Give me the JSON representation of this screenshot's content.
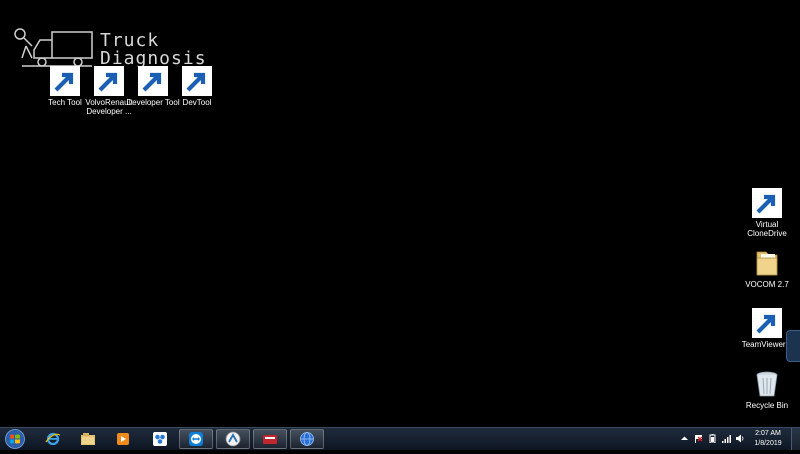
{
  "watermark": {
    "line1": "Truck",
    "line2": "Diagnosis"
  },
  "desktop_icons_top": [
    {
      "label": "Tech Tool",
      "icon": "techtool-icon"
    },
    {
      "label": "VolvoRenault Developer ...",
      "icon": "volvorenault-developer-icon"
    },
    {
      "label": "Developer Tool",
      "icon": "developer-tool-icon"
    },
    {
      "label": "DevTool",
      "icon": "volvo-devtool-icon"
    }
  ],
  "desktop_icons_right": [
    {
      "label": "Virtual CloneDrive",
      "icon": "virtual-clonedrive-icon"
    },
    {
      "label": "VOCOM 2.7",
      "icon": "folder-icon"
    },
    {
      "label": "TeamViewer 7",
      "icon": "teamviewer-icon"
    },
    {
      "label": "Recycle Bin",
      "icon": "recycle-bin-icon"
    }
  ],
  "taskbar": {
    "pinned": [
      {
        "name": "internet-explorer",
        "icon": "internet-explorer-icon"
      },
      {
        "name": "file-explorer",
        "icon": "file-explorer-icon"
      },
      {
        "name": "media-player",
        "icon": "media-player-icon"
      },
      {
        "name": "network-app",
        "icon": "network-icon"
      },
      {
        "name": "teamviewer",
        "icon": "teamviewer-icon"
      },
      {
        "name": "tech-tool",
        "icon": "techtool-icon"
      },
      {
        "name": "vocom-app",
        "icon": "vocom-icon"
      },
      {
        "name": "remote-app",
        "icon": "globe-icon"
      }
    ]
  },
  "clock": {
    "time": "2:07 AM",
    "date": "1/8/2019"
  }
}
